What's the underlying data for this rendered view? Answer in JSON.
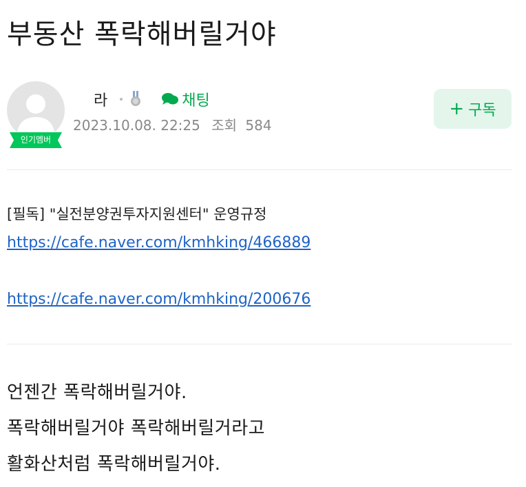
{
  "post": {
    "title": "부동산 폭락해버릴거야"
  },
  "author": {
    "name": "라",
    "badge": "인기멤버",
    "avatar_icon": "default-profile-icon",
    "medal_icon": "medal-icon",
    "chat_icon": "chat-bubble-icon",
    "chat_label": "채팅"
  },
  "meta": {
    "date": "2023.10.08. 22:25",
    "views_label": "조회",
    "views_count": "584"
  },
  "subscribe": {
    "plus": "+",
    "label": "구독"
  },
  "notice": {
    "line": "[필독] \"실전분양권투자지원센터\" 운영규정",
    "link1": "https://cafe.naver.com/kmhking/466889",
    "link2": "https://cafe.naver.com/kmhking/200676"
  },
  "content": {
    "lines": [
      "언젠간 폭락해버릴거야.",
      "폭락해버릴거야  폭락해버릴거라고",
      "활화산처럼 폭락해버릴거야."
    ]
  },
  "colors": {
    "accent_green": "#03c75a",
    "link_blue": "#1e63c6",
    "meta_gray": "#888888"
  }
}
